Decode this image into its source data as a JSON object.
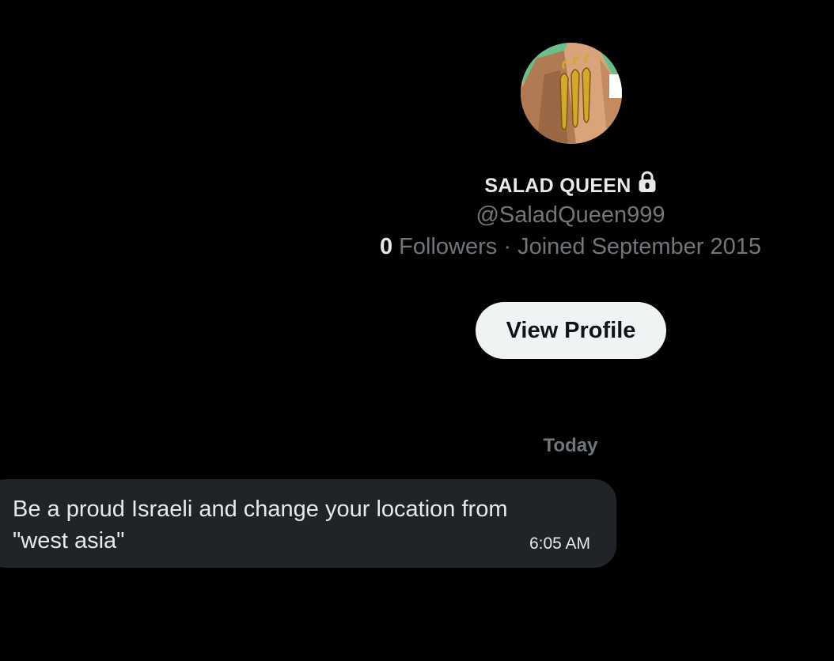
{
  "profile": {
    "display_name": "SALAD QUEEN",
    "handle": "@SaladQueen999",
    "followers_count": "0",
    "followers_label": "Followers",
    "separator": "·",
    "joined": "Joined September 2015",
    "avatar_icon": "avatar-image",
    "verified_icon": "lock-icon"
  },
  "actions": {
    "view_profile_label": "View Profile"
  },
  "conversation": {
    "date_divider": "Today",
    "messages": [
      {
        "text": "Be a proud Israeli and change your location from \"west asia\"",
        "time": "6:05 AM"
      }
    ]
  },
  "colors": {
    "background": "#000000",
    "primary_text": "#e7e9ea",
    "secondary_text": "#71767b",
    "button_bg": "#eff3f4",
    "bubble_bg": "#202327"
  }
}
